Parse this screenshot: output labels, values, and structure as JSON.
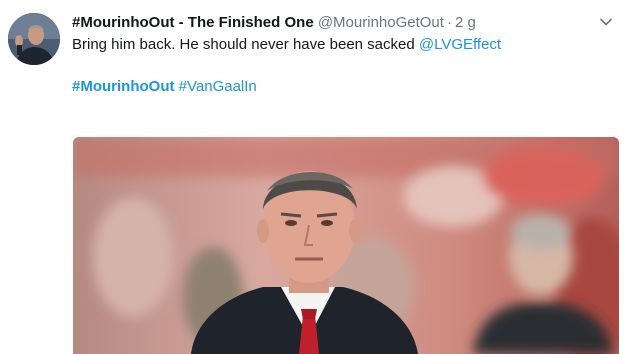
{
  "tweet": {
    "display_name": "#MourinhoOut - The Finished One",
    "handle": "@MourinhoGetOut",
    "separator": "·",
    "time": "2 g",
    "text_main": "Bring him back. He should never have been sacked ",
    "mention": "@LVGEffect",
    "hashtag_1": "#MourinhoOut",
    "hashtag_2": "#VanGaalIn"
  },
  "icons": {
    "menu": "chevron-down-icon",
    "avatar": "avatar-photo"
  },
  "colors": {
    "link": "#1b95e0",
    "text": "#14171a",
    "secondary": "#657786"
  }
}
